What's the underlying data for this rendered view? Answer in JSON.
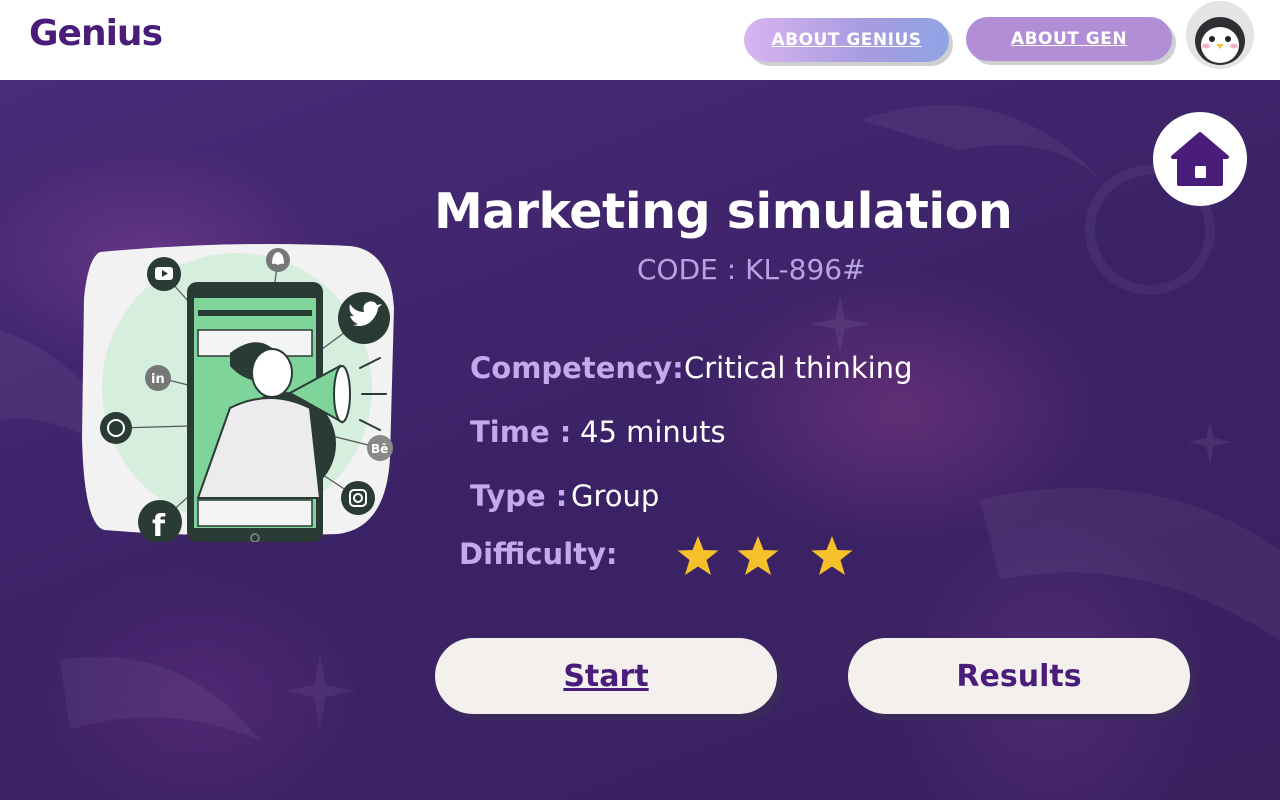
{
  "header": {
    "logo": "Genius",
    "nav": [
      {
        "label": "ABOUT GENIUS"
      },
      {
        "label": "ABOUT GEN"
      }
    ]
  },
  "simulation": {
    "title": "Marketing simulation",
    "code": "CODE : KL-896#",
    "competency_label": "Competency:",
    "competency_value": "Critical thinking",
    "time_label": "Time :",
    "time_value": "45 minuts",
    "type_label": "Type :",
    "type_value": "Group",
    "difficulty_label": "Difficulty:",
    "difficulty_stars": 3,
    "star_color": "#f5c02a"
  },
  "actions": {
    "start_label": "Start",
    "results_label": "Results"
  },
  "illustration": {
    "social_badges": {
      "linkedin": "in",
      "behance": "Bē",
      "facebook": "f"
    }
  },
  "colors": {
    "brand": "#4a1d7a",
    "label_purple": "#c6a9ec",
    "code_purple": "#b8a2e2",
    "illustration_green": "#7fd49a"
  }
}
